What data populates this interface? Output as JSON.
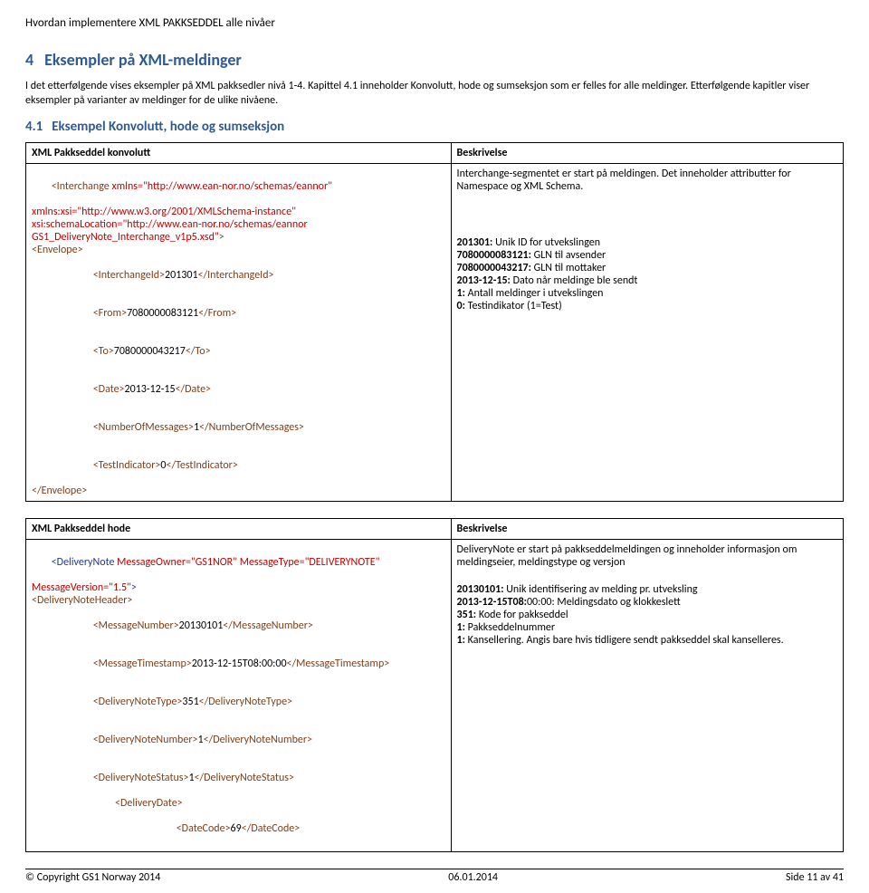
{
  "header": "Hvordan implementere XML PAKKSEDDEL alle nivåer",
  "section": {
    "num": "4",
    "title": "Eksempler på XML-meldinger"
  },
  "intro": "I det etterfølgende vises eksempler på XML pakksedler nivå 1-4. Kapittel 4.1 inneholder Konvolutt, hode og sumseksjon som er felles for alle meldinger. Etterfølgende kapitler viser eksempler på varianter av meldinger for de ulike nivåene.",
  "subsection": {
    "num": "4.1",
    "title": "Eksempel Konvolutt, hode og sumseksjon"
  },
  "table1": {
    "h1": "XML Pakkseddel konvolutt",
    "h2": "Beskrivelse",
    "xml": {
      "l1a": "<Interchange ",
      "l1b": "xmlns=\"http://www.ean-nor.no/schemas/eannor\"",
      "l2a": "xmlns:xsi=\"http://www.w3.org/2001/XMLSchema-instance\"",
      "l3a": "xsi:schemaLocation=\"http://www.ean-nor.no/schemas/eannor",
      "l4a": "GS1_DeliveryNote_Interchange_v1p5.xsd\"",
      "l4b": ">",
      "l5": "<Envelope>",
      "l6a": "<InterchangeId>",
      "l6b": "201301",
      "l6c": "</InterchangeId>",
      "l7a": "<From>",
      "l7b": "7080000083121",
      "l7c": "</From>",
      "l8a": "<To>",
      "l8b": "7080000043217",
      "l8c": "</To>",
      "l9a": "<Date>",
      "l9b": "2013-12-15",
      "l9c": "</Date>",
      "l10a": "<NumberOfMessages>",
      "l10b": "1",
      "l10c": "</NumberOfMessages>",
      "l11a": "<TestIndicator>",
      "l11b": "0",
      "l11c": "</TestIndicator>",
      "l12": "</Envelope>"
    },
    "desc": {
      "d1": "Interchange-segmentet er start på meldingen. Det inneholder attributter for Namespace og XML Schema.",
      "d2": "201301: Unik ID for utvekslingen",
      "d3": "7080000083121: GLN til avsender",
      "d4": "7080000043217: GLN til mottaker",
      "d5": "2013-12-15: Dato når meldinge ble sendt",
      "d6": "1: Antall meldinger i utvekslingen",
      "d7": "0: Testindikator (1=Test)"
    }
  },
  "table2": {
    "h1": "XML Pakkseddel hode",
    "h2": "Beskrivelse",
    "xml": {
      "l1a": "<DeliveryNote ",
      "l1b": "MessageOwner=\"GS1NOR\" ",
      "l1c": "MessageType=\"DELIVERYNOTE\"",
      "l2a": "MessageVersion=\"1.5\"",
      "l2b": ">",
      "l3": "<DeliveryNoteHeader>",
      "l4a": "<MessageNumber>",
      "l4b": "20130101",
      "l4c": "</MessageNumber>",
      "l5a": "<MessageTimestamp>",
      "l5b": "2013-12-15T08:00:00",
      "l5c": "</MessageTimestamp>",
      "l6a": "<DeliveryNoteType>",
      "l6b": "351",
      "l6c": "</DeliveryNoteType>",
      "l7a": "<DeliveryNoteNumber>",
      "l7b": "1",
      "l7c": "</DeliveryNoteNumber>",
      "l8a": "<DeliveryNoteStatus>",
      "l8b": "1",
      "l8c": "</DeliveryNoteStatus>",
      "l9": "<DeliveryDate>",
      "l10a": "<DateCode>",
      "l10b": "69",
      "l10c": "</DateCode>"
    },
    "desc": {
      "d1": "DeliveryNote er start på pakkseddelmeldingen og inneholder informasjon om meldingseier, meldingstype og versjon",
      "d2": "20130101: Unik identifisering av melding pr. utveksling",
      "d3": "2013-12-15T08:00:00: Meldingsdato og klokkeslett",
      "d4": "351: Kode for pakkseddel",
      "d5": "1: Pakkseddelnummer",
      "d6": "1: Kansellering. Angis bare hvis tidligere sendt pakkseddel skal kanselleres."
    }
  },
  "footer": {
    "left": "© Copyright GS1 Norway 2014",
    "center": "06.01.2014",
    "right": "Side 11 av 41"
  }
}
